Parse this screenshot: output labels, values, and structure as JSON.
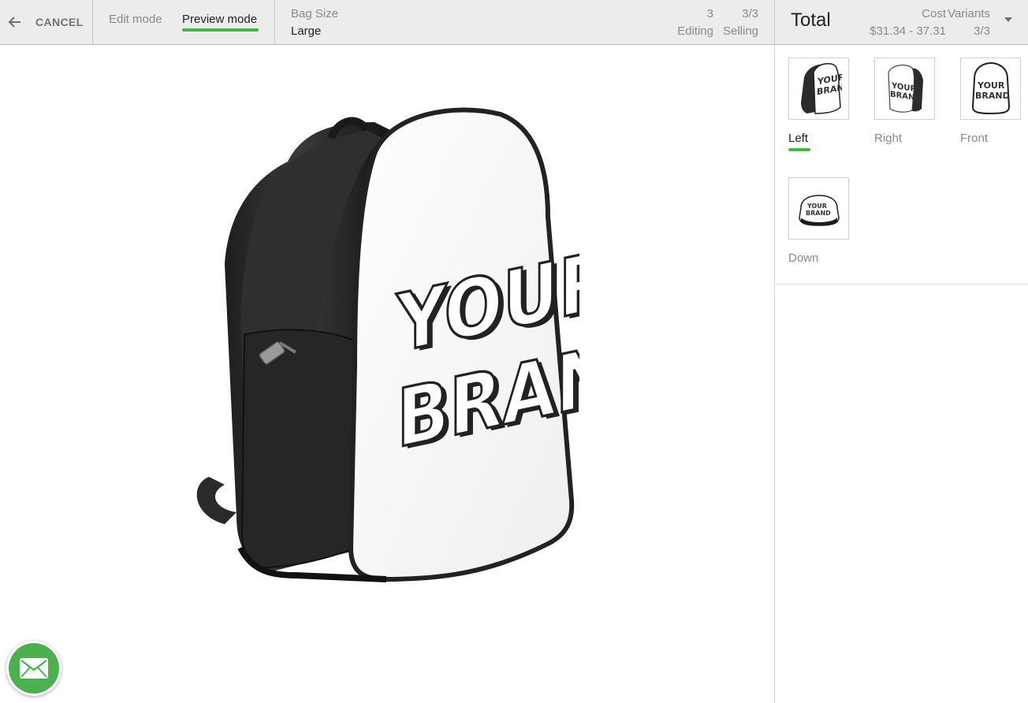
{
  "toolbar": {
    "cancel_label": "CANCEL",
    "tabs": [
      {
        "label": "Edit mode",
        "active": false
      },
      {
        "label": "Preview mode",
        "active": true
      }
    ],
    "option": {
      "label": "Bag Size",
      "value": "Large"
    },
    "stats": {
      "editing_count": "3",
      "editing_label": "Editing",
      "selling_count": "3/3",
      "selling_label": "Selling"
    }
  },
  "summary": {
    "title": "Total",
    "cost_label": "Cost",
    "cost_value": "$31.34 - 37.31",
    "variants_label": "Variants",
    "variants_value": "3/3"
  },
  "views": [
    {
      "label": "Left",
      "active": true
    },
    {
      "label": "Right",
      "active": false
    },
    {
      "label": "Front",
      "active": false
    },
    {
      "label": "Down",
      "active": false
    }
  ],
  "product_print": {
    "line1": "YOUR",
    "line2": "BRAND"
  },
  "colors": {
    "accent": "#4caf50",
    "toolbar_bg": "#ececec",
    "bag_black": "#2a2a2a"
  },
  "icons": {
    "back": "arrow-left-icon",
    "dropdown": "triangle-down-icon",
    "chat": "envelope-icon"
  }
}
